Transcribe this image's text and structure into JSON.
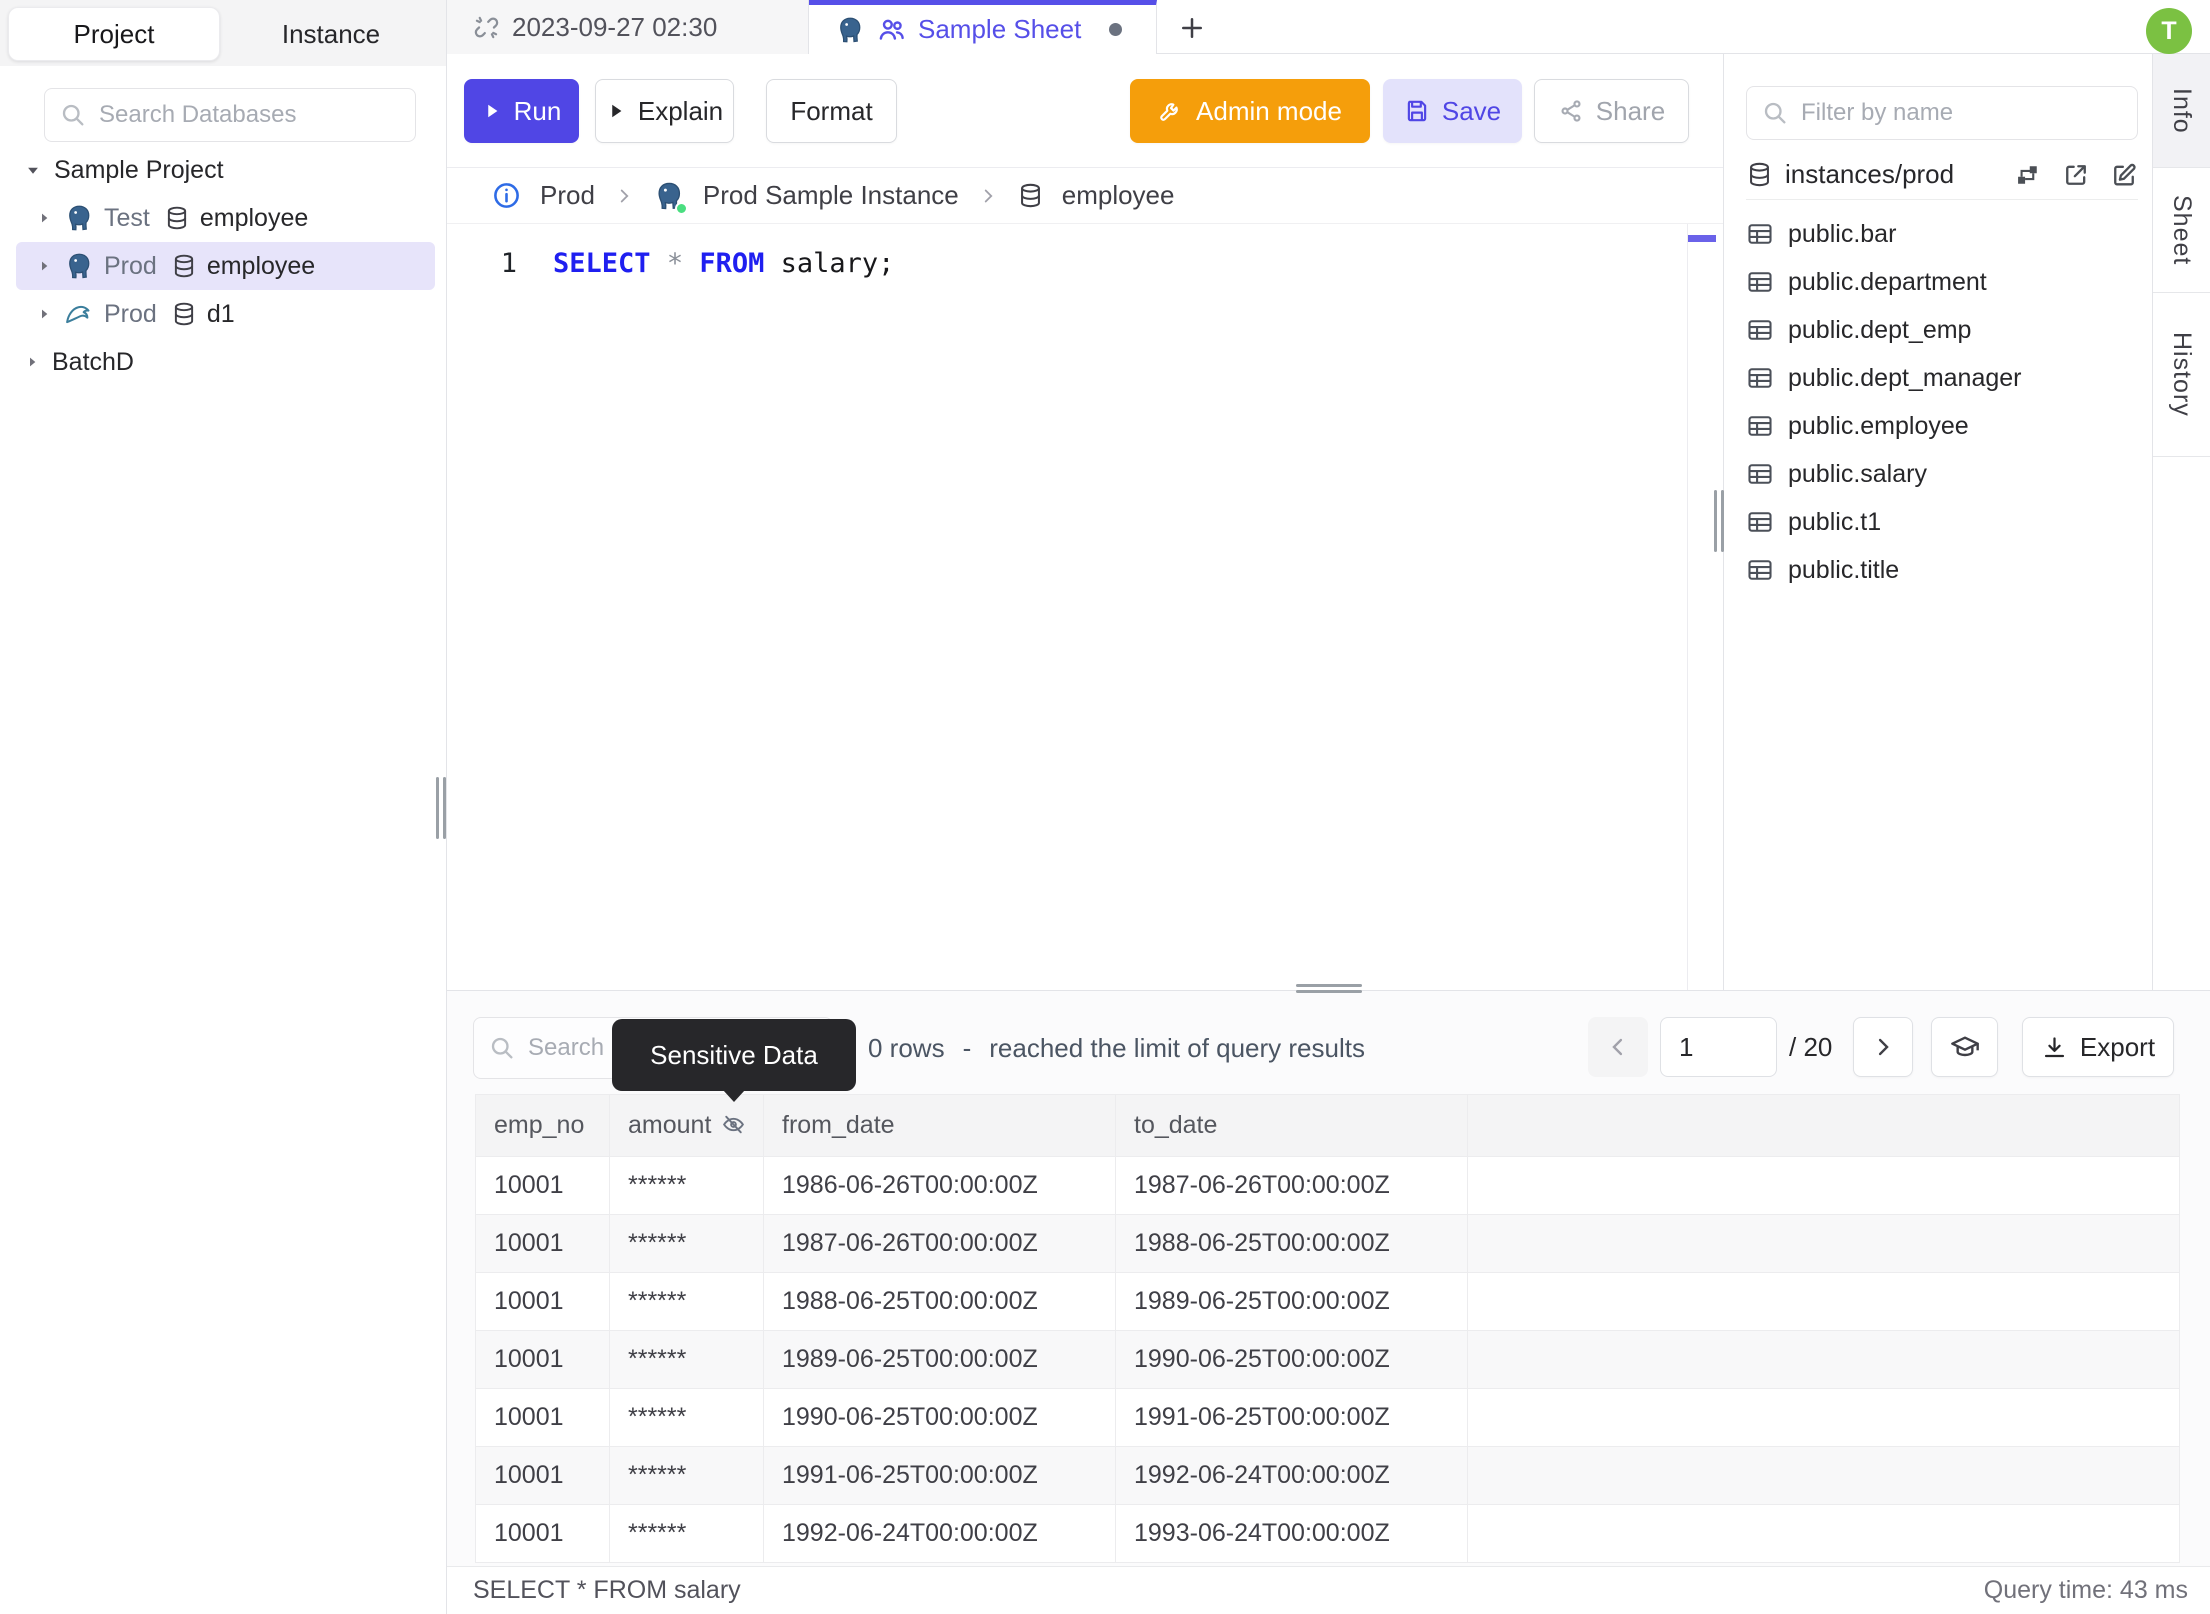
{
  "topbar": {
    "tabs": [
      {
        "label": "2023-09-27 02:30"
      },
      {
        "label": "Sample Sheet"
      }
    ],
    "new_tab_label": "+",
    "avatar_initial": "T"
  },
  "left_sidebar": {
    "tabs": {
      "project": "Project",
      "instance": "Instance"
    },
    "search_placeholder": "Search Databases",
    "tree": {
      "root_label": "Sample Project",
      "connections": [
        {
          "env": "Test",
          "db": "employee",
          "engine": "postgres"
        },
        {
          "env": "Prod",
          "db": "employee",
          "engine": "postgres",
          "selected": true
        },
        {
          "env": "Prod",
          "db": "d1",
          "engine": "mysql"
        }
      ],
      "batch_label": "BatchD"
    }
  },
  "toolbar": {
    "run_label": "Run",
    "explain_label": "Explain",
    "format_label": "Format",
    "admin_mode_label": "Admin mode",
    "save_label": "Save",
    "share_label": "Share"
  },
  "breadcrumb": {
    "env": "Prod",
    "instance": "Prod Sample Instance",
    "database": "employee"
  },
  "editor": {
    "line_number": "1",
    "tokens": {
      "kw1": "SELECT",
      "star": "*",
      "kw2": "FROM",
      "tail": "salary;"
    }
  },
  "right_sidebar": {
    "filter_placeholder": "Filter by name",
    "connection": "instances/prod",
    "tables": [
      "public.bar",
      "public.department",
      "public.dept_emp",
      "public.dept_manager",
      "public.employee",
      "public.salary",
      "public.t1",
      "public.title"
    ]
  },
  "right_strip": {
    "tabs": [
      "Info",
      "Sheet",
      "History"
    ]
  },
  "results": {
    "search_placeholder": "Search",
    "tooltip": "Sensitive Data",
    "rows_label": "0 rows",
    "separator": "-",
    "limit_label": "reached the limit of query results",
    "pagination": {
      "page": "1",
      "total_label": "/ 20"
    },
    "export_label": "Export",
    "table": {
      "columns": [
        "emp_no",
        "amount",
        "from_date",
        "to_date"
      ],
      "rows": [
        [
          "10001",
          "******",
          "1986-06-26T00:00:00Z",
          "1987-06-26T00:00:00Z"
        ],
        [
          "10001",
          "******",
          "1987-06-26T00:00:00Z",
          "1988-06-25T00:00:00Z"
        ],
        [
          "10001",
          "******",
          "1988-06-25T00:00:00Z",
          "1989-06-25T00:00:00Z"
        ],
        [
          "10001",
          "******",
          "1989-06-25T00:00:00Z",
          "1990-06-25T00:00:00Z"
        ],
        [
          "10001",
          "******",
          "1990-06-25T00:00:00Z",
          "1991-06-25T00:00:00Z"
        ],
        [
          "10001",
          "******",
          "1991-06-25T00:00:00Z",
          "1992-06-24T00:00:00Z"
        ],
        [
          "10001",
          "******",
          "1992-06-24T00:00:00Z",
          "1993-06-24T00:00:00Z"
        ]
      ]
    }
  },
  "status_bar": {
    "left": "SELECT * FROM salary",
    "right": "Query time: 43 ms"
  },
  "colors": {
    "accent": "#5046e5",
    "admin_orange": "#f59e0b",
    "avatar_green": "#7bc142",
    "keyword_blue": "#1f1ff0",
    "selected_row": "#e7e4fa",
    "tooltip_bg": "#27272a"
  }
}
